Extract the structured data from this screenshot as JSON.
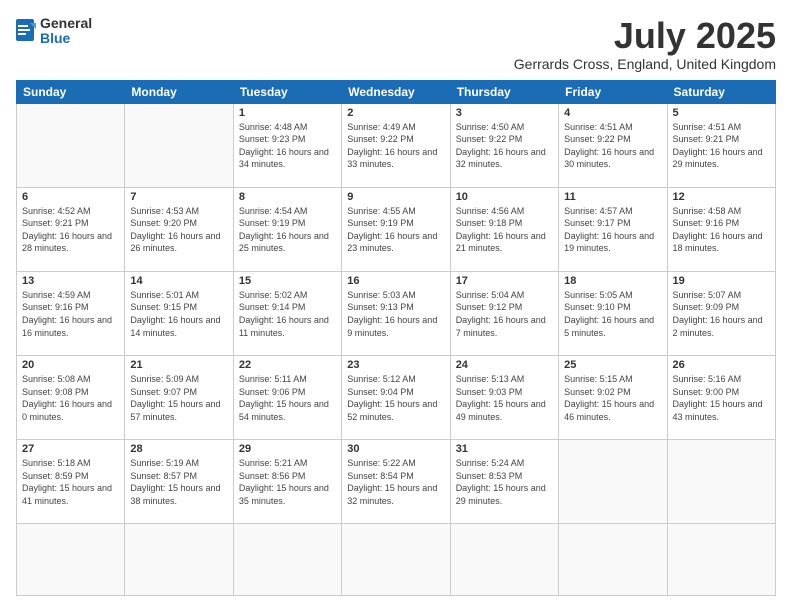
{
  "logo": {
    "general": "General",
    "blue": "Blue"
  },
  "title": "July 2025",
  "location": "Gerrards Cross, England, United Kingdom",
  "weekdays": [
    "Sunday",
    "Monday",
    "Tuesday",
    "Wednesday",
    "Thursday",
    "Friday",
    "Saturday"
  ],
  "days": [
    {
      "day": null
    },
    {
      "day": null
    },
    {
      "day": 1,
      "sunrise": "4:48 AM",
      "sunset": "9:23 PM",
      "daylight": "16 hours and 34 minutes."
    },
    {
      "day": 2,
      "sunrise": "4:49 AM",
      "sunset": "9:22 PM",
      "daylight": "16 hours and 33 minutes."
    },
    {
      "day": 3,
      "sunrise": "4:50 AM",
      "sunset": "9:22 PM",
      "daylight": "16 hours and 32 minutes."
    },
    {
      "day": 4,
      "sunrise": "4:51 AM",
      "sunset": "9:22 PM",
      "daylight": "16 hours and 30 minutes."
    },
    {
      "day": 5,
      "sunrise": "4:51 AM",
      "sunset": "9:21 PM",
      "daylight": "16 hours and 29 minutes."
    },
    {
      "day": 6,
      "sunrise": "4:52 AM",
      "sunset": "9:21 PM",
      "daylight": "16 hours and 28 minutes."
    },
    {
      "day": 7,
      "sunrise": "4:53 AM",
      "sunset": "9:20 PM",
      "daylight": "16 hours and 26 minutes."
    },
    {
      "day": 8,
      "sunrise": "4:54 AM",
      "sunset": "9:19 PM",
      "daylight": "16 hours and 25 minutes."
    },
    {
      "day": 9,
      "sunrise": "4:55 AM",
      "sunset": "9:19 PM",
      "daylight": "16 hours and 23 minutes."
    },
    {
      "day": 10,
      "sunrise": "4:56 AM",
      "sunset": "9:18 PM",
      "daylight": "16 hours and 21 minutes."
    },
    {
      "day": 11,
      "sunrise": "4:57 AM",
      "sunset": "9:17 PM",
      "daylight": "16 hours and 19 minutes."
    },
    {
      "day": 12,
      "sunrise": "4:58 AM",
      "sunset": "9:16 PM",
      "daylight": "16 hours and 18 minutes."
    },
    {
      "day": 13,
      "sunrise": "4:59 AM",
      "sunset": "9:16 PM",
      "daylight": "16 hours and 16 minutes."
    },
    {
      "day": 14,
      "sunrise": "5:01 AM",
      "sunset": "9:15 PM",
      "daylight": "16 hours and 14 minutes."
    },
    {
      "day": 15,
      "sunrise": "5:02 AM",
      "sunset": "9:14 PM",
      "daylight": "16 hours and 11 minutes."
    },
    {
      "day": 16,
      "sunrise": "5:03 AM",
      "sunset": "9:13 PM",
      "daylight": "16 hours and 9 minutes."
    },
    {
      "day": 17,
      "sunrise": "5:04 AM",
      "sunset": "9:12 PM",
      "daylight": "16 hours and 7 minutes."
    },
    {
      "day": 18,
      "sunrise": "5:05 AM",
      "sunset": "9:10 PM",
      "daylight": "16 hours and 5 minutes."
    },
    {
      "day": 19,
      "sunrise": "5:07 AM",
      "sunset": "9:09 PM",
      "daylight": "16 hours and 2 minutes."
    },
    {
      "day": 20,
      "sunrise": "5:08 AM",
      "sunset": "9:08 PM",
      "daylight": "16 hours and 0 minutes."
    },
    {
      "day": 21,
      "sunrise": "5:09 AM",
      "sunset": "9:07 PM",
      "daylight": "15 hours and 57 minutes."
    },
    {
      "day": 22,
      "sunrise": "5:11 AM",
      "sunset": "9:06 PM",
      "daylight": "15 hours and 54 minutes."
    },
    {
      "day": 23,
      "sunrise": "5:12 AM",
      "sunset": "9:04 PM",
      "daylight": "15 hours and 52 minutes."
    },
    {
      "day": 24,
      "sunrise": "5:13 AM",
      "sunset": "9:03 PM",
      "daylight": "15 hours and 49 minutes."
    },
    {
      "day": 25,
      "sunrise": "5:15 AM",
      "sunset": "9:02 PM",
      "daylight": "15 hours and 46 minutes."
    },
    {
      "day": 26,
      "sunrise": "5:16 AM",
      "sunset": "9:00 PM",
      "daylight": "15 hours and 43 minutes."
    },
    {
      "day": 27,
      "sunrise": "5:18 AM",
      "sunset": "8:59 PM",
      "daylight": "15 hours and 41 minutes."
    },
    {
      "day": 28,
      "sunrise": "5:19 AM",
      "sunset": "8:57 PM",
      "daylight": "15 hours and 38 minutes."
    },
    {
      "day": 29,
      "sunrise": "5:21 AM",
      "sunset": "8:56 PM",
      "daylight": "15 hours and 35 minutes."
    },
    {
      "day": 30,
      "sunrise": "5:22 AM",
      "sunset": "8:54 PM",
      "daylight": "15 hours and 32 minutes."
    },
    {
      "day": 31,
      "sunrise": "5:24 AM",
      "sunset": "8:53 PM",
      "daylight": "15 hours and 29 minutes."
    },
    {
      "day": null
    },
    {
      "day": null
    },
    {
      "day": null
    },
    {
      "day": null
    },
    {
      "day": null
    },
    {
      "day": null
    }
  ]
}
